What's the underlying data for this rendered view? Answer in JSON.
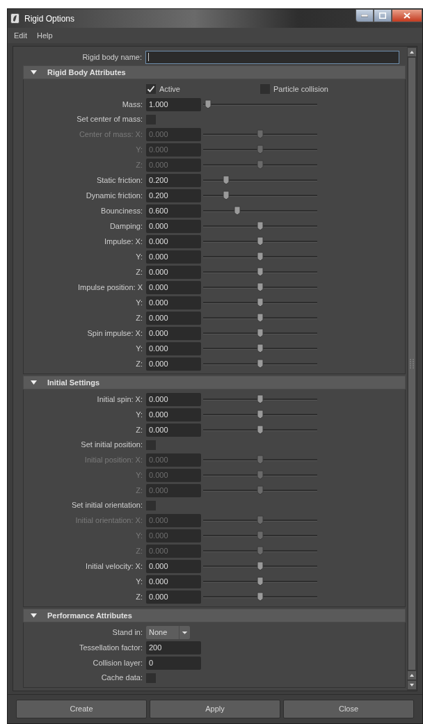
{
  "window": {
    "title": "Rigid Options"
  },
  "menu": [
    "Edit",
    "Help"
  ],
  "name_field": {
    "label": "Rigid body name:"
  },
  "sections": [
    {
      "title": "Rigid Body Attributes",
      "expanded": true,
      "rows": [
        {
          "kind": "checkpair",
          "items": [
            {
              "label": "Active",
              "checked": true
            },
            {
              "label": "Particle collision",
              "checked": false
            }
          ]
        },
        {
          "kind": "slider",
          "label": "Mass:",
          "value": "1.000",
          "level": 0.04,
          "disabled": false
        },
        {
          "kind": "check",
          "label": "Set center of mass:",
          "checked": false
        },
        {
          "kind": "slider",
          "label": "Center of mass: X:",
          "value": "0.000",
          "level": 0.5,
          "disabled": true
        },
        {
          "kind": "slider",
          "label": "Y:",
          "value": "0.000",
          "level": 0.5,
          "disabled": true
        },
        {
          "kind": "slider",
          "label": "Z:",
          "value": "0.000",
          "level": 0.5,
          "disabled": true
        },
        {
          "kind": "slider",
          "label": "Static friction:",
          "value": "0.200",
          "level": 0.2,
          "disabled": false
        },
        {
          "kind": "slider",
          "label": "Dynamic friction:",
          "value": "0.200",
          "level": 0.2,
          "disabled": false
        },
        {
          "kind": "slider",
          "label": "Bounciness:",
          "value": "0.600",
          "level": 0.3,
          "disabled": false
        },
        {
          "kind": "slider",
          "label": "Damping:",
          "value": "0.000",
          "level": 0.5,
          "disabled": false
        },
        {
          "kind": "slider",
          "label": "Impulse: X:",
          "value": "0.000",
          "level": 0.5,
          "disabled": false
        },
        {
          "kind": "slider",
          "label": "Y:",
          "value": "0.000",
          "level": 0.5,
          "disabled": false
        },
        {
          "kind": "slider",
          "label": "Z:",
          "value": "0.000",
          "level": 0.5,
          "disabled": false
        },
        {
          "kind": "slider",
          "label": "Impulse position: X",
          "value": "0.000",
          "level": 0.5,
          "disabled": false
        },
        {
          "kind": "slider",
          "label": "Y:",
          "value": "0.000",
          "level": 0.5,
          "disabled": false
        },
        {
          "kind": "slider",
          "label": "Z:",
          "value": "0.000",
          "level": 0.5,
          "disabled": false
        },
        {
          "kind": "slider",
          "label": "Spin impulse: X:",
          "value": "0.000",
          "level": 0.5,
          "disabled": false
        },
        {
          "kind": "slider",
          "label": "Y:",
          "value": "0.000",
          "level": 0.5,
          "disabled": false
        },
        {
          "kind": "slider",
          "label": "Z:",
          "value": "0.000",
          "level": 0.5,
          "disabled": false
        }
      ]
    },
    {
      "title": "Initial Settings",
      "expanded": true,
      "rows": [
        {
          "kind": "slider",
          "label": "Initial spin: X:",
          "value": "0.000",
          "level": 0.5,
          "disabled": false
        },
        {
          "kind": "slider",
          "label": "Y:",
          "value": "0.000",
          "level": 0.5,
          "disabled": false
        },
        {
          "kind": "slider",
          "label": "Z:",
          "value": "0.000",
          "level": 0.5,
          "disabled": false
        },
        {
          "kind": "check",
          "label": "Set initial position:",
          "checked": false
        },
        {
          "kind": "slider",
          "label": "Initial position: X:",
          "value": "0.000",
          "level": 0.5,
          "disabled": true
        },
        {
          "kind": "slider",
          "label": "Y:",
          "value": "0.000",
          "level": 0.5,
          "disabled": true
        },
        {
          "kind": "slider",
          "label": "Z:",
          "value": "0.000",
          "level": 0.5,
          "disabled": true
        },
        {
          "kind": "check",
          "label": "Set initial orientation:",
          "checked": false
        },
        {
          "kind": "slider",
          "label": "Initial orientation: X:",
          "value": "0.000",
          "level": 0.5,
          "disabled": true
        },
        {
          "kind": "slider",
          "label": "Y:",
          "value": "0.000",
          "level": 0.5,
          "disabled": true
        },
        {
          "kind": "slider",
          "label": "Z:",
          "value": "0.000",
          "level": 0.5,
          "disabled": true
        },
        {
          "kind": "slider",
          "label": "Initial velocity: X:",
          "value": "0.000",
          "level": 0.5,
          "disabled": false
        },
        {
          "kind": "slider",
          "label": "Y:",
          "value": "0.000",
          "level": 0.5,
          "disabled": false
        },
        {
          "kind": "slider",
          "label": "Z:",
          "value": "0.000",
          "level": 0.5,
          "disabled": false
        }
      ]
    },
    {
      "title": "Performance Attributes",
      "expanded": true,
      "rows": [
        {
          "kind": "dropdown",
          "label": "Stand in:",
          "value": "None"
        },
        {
          "kind": "field",
          "label": "Tessellation factor:",
          "value": "200"
        },
        {
          "kind": "field",
          "label": "Collision layer:",
          "value": "0"
        },
        {
          "kind": "check",
          "label": "Cache data:",
          "checked": false
        }
      ]
    }
  ],
  "buttons": [
    "Create",
    "Apply",
    "Close"
  ]
}
